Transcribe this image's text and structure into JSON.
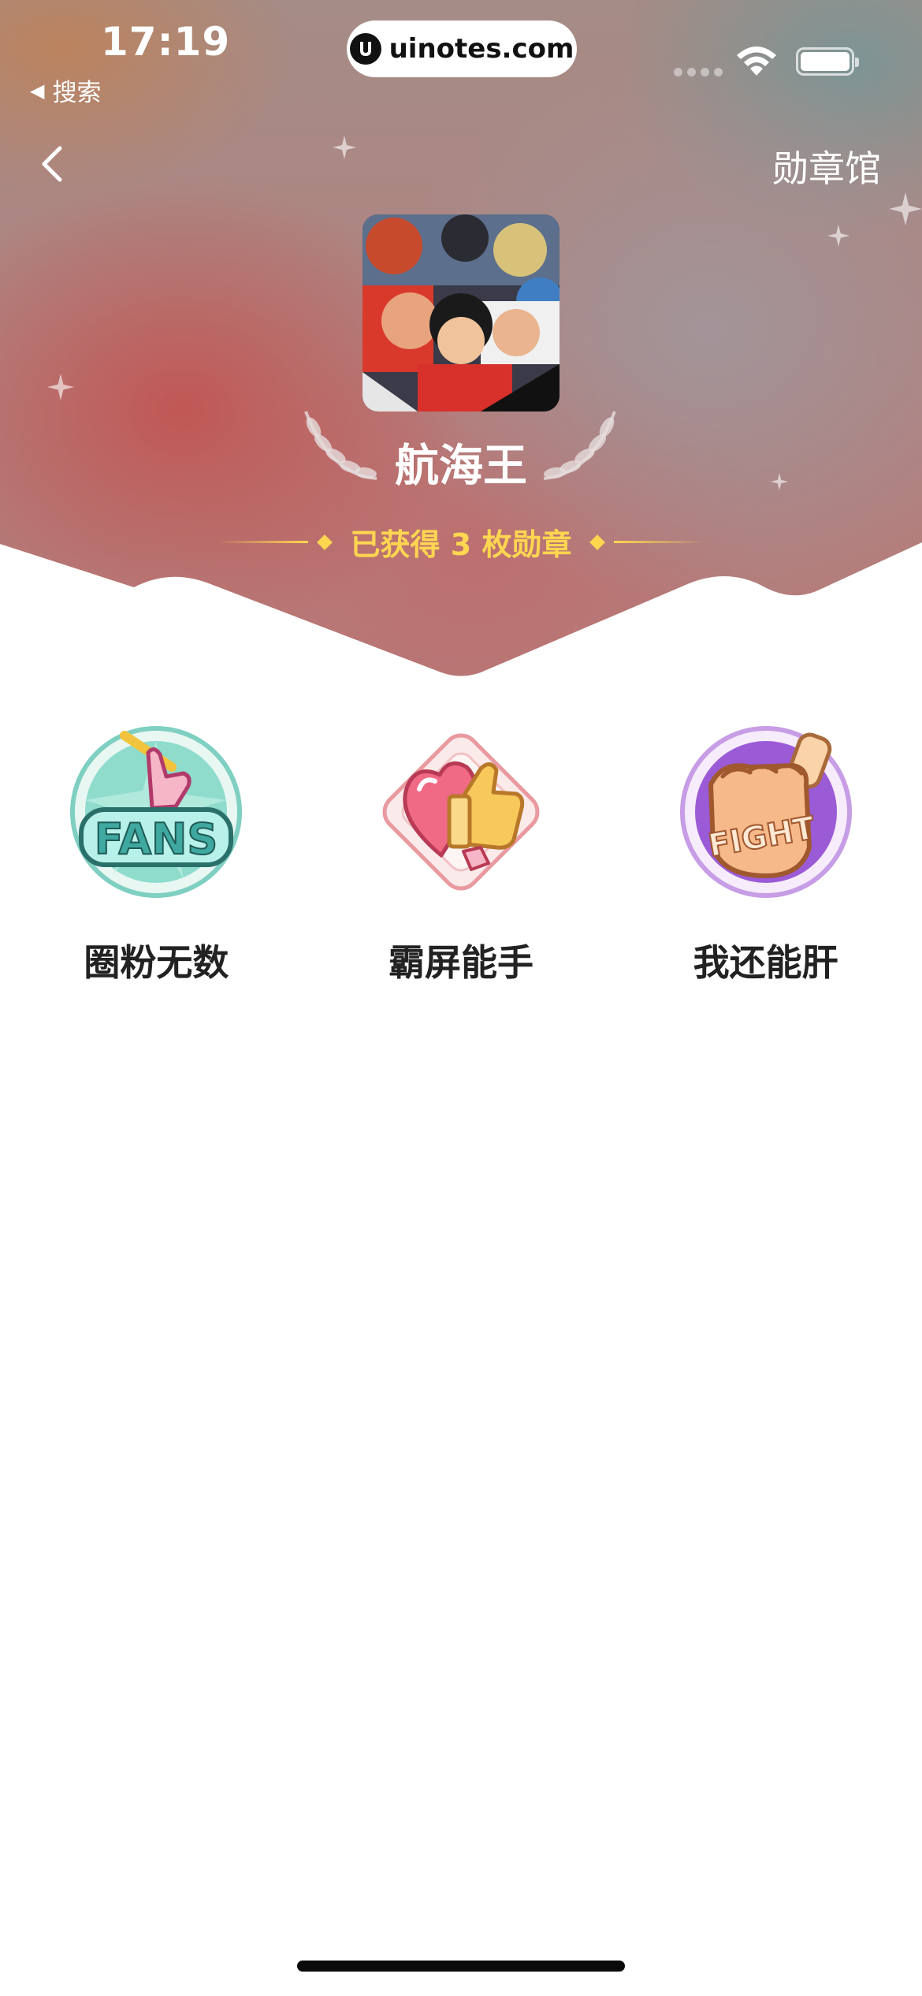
{
  "status_bar": {
    "time": "17:19",
    "back_app": "搜索",
    "url": "uinotes.com"
  },
  "nav": {
    "title": "勋章馆",
    "back_icon": "chevron-left-icon"
  },
  "topic": {
    "name": "航海王",
    "earned_text": "已获得 3 枚勋章"
  },
  "badges": [
    {
      "label": "圈粉无数",
      "icon": "fans-badge-icon",
      "icon_text": "FANS"
    },
    {
      "label": "霸屏能手",
      "icon": "heart-thumbs-badge-icon"
    },
    {
      "label": "我还能肝",
      "icon": "fight-badge-icon",
      "icon_text": "FIGHT"
    }
  ],
  "colors": {
    "accent_gold": "#ffd650",
    "text_dark": "#222222",
    "white": "#ffffff"
  }
}
